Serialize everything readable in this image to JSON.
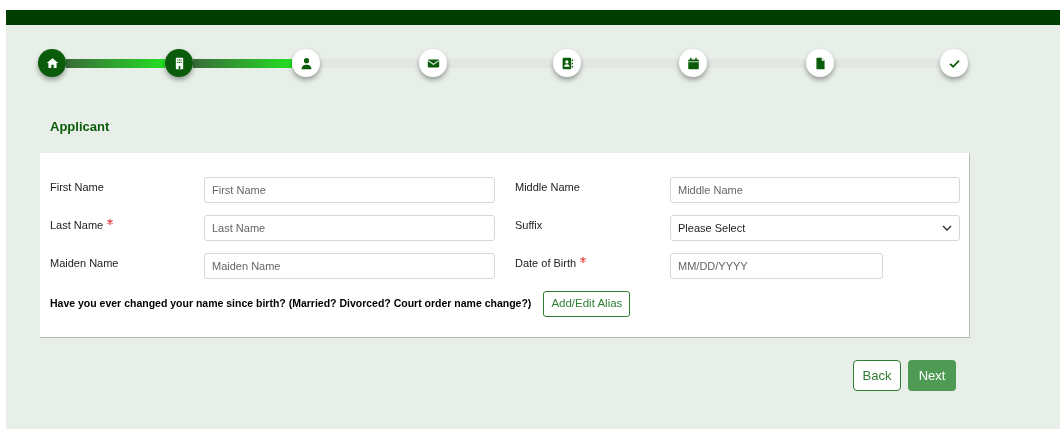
{
  "stepper": {
    "steps": [
      {
        "kind": "home",
        "completed": true
      },
      {
        "kind": "building",
        "completed": true
      },
      {
        "kind": "person",
        "completed": false
      },
      {
        "kind": "envelope",
        "completed": false
      },
      {
        "kind": "contact-book",
        "completed": false
      },
      {
        "kind": "calendar",
        "completed": false
      },
      {
        "kind": "document",
        "completed": false
      },
      {
        "kind": "check",
        "completed": false
      }
    ]
  },
  "section_title": "Applicant",
  "fields": [
    {
      "label": "First Name",
      "required": false,
      "kind": "text",
      "placeholder": "First Name"
    },
    {
      "label": "Middle Name",
      "required": false,
      "kind": "text",
      "placeholder": "Middle Name"
    },
    {
      "label": "Last Name",
      "required": true,
      "kind": "text",
      "placeholder": "Last Name"
    },
    {
      "label": "Suffix",
      "required": false,
      "kind": "select",
      "value": "Please Select"
    },
    {
      "label": "Maiden Name",
      "required": false,
      "kind": "text",
      "placeholder": "Maiden Name"
    },
    {
      "label": "Date of Birth",
      "required": true,
      "kind": "date",
      "placeholder": "MM/DD/YYYY"
    }
  ],
  "alias_question": "Have you ever changed your name since birth? (Married? Divorced? Court order name change?)",
  "alias_button": "Add/Edit Alias",
  "buttons": {
    "back": "Back",
    "next": "Next"
  }
}
